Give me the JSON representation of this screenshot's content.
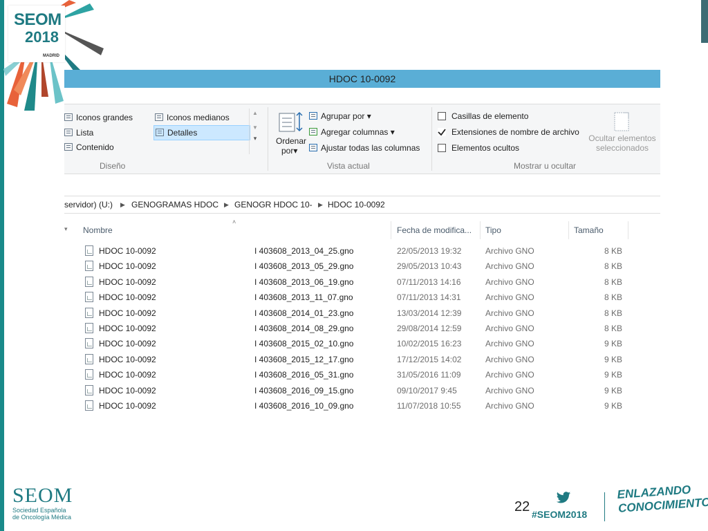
{
  "branding": {
    "logo_text": "SEOM",
    "logo_year": "2018",
    "logo_city": "MADRID",
    "accent_color": "#1f7a82",
    "footer_logo": "SEOM",
    "footer_society_line1": "Sociedad Española",
    "footer_society_line2": "de Oncología Médica",
    "page_number": "22",
    "hashtag": "#SEOM2018",
    "slogan_line1": "ENLAZANDO",
    "slogan_line2": "CONOCIMIENTO"
  },
  "window": {
    "title": "HDOC 10-0092",
    "titlebar_color": "#5aaed6"
  },
  "ribbon": {
    "layout": {
      "items": [
        {
          "label": "Iconos grandes",
          "icon": "large-icons-icon"
        },
        {
          "label": "Iconos medianos",
          "icon": "medium-icons-icon"
        },
        {
          "label": "Lista",
          "icon": "list-icon"
        },
        {
          "label": "Detalles",
          "icon": "details-icon",
          "selected": true
        },
        {
          "label": "Contenido",
          "icon": "content-icon"
        }
      ],
      "group_label": "Diseño"
    },
    "current_view": {
      "sort_label": "Ordenar",
      "sort_label2": "por",
      "group_by": "Agrupar por",
      "add_columns": "Agregar columnas",
      "fit_columns": "Ajustar todas las columnas",
      "group_label": "Vista actual"
    },
    "show_hide": {
      "item_checkboxes": {
        "label": "Casillas de elemento",
        "checked": false
      },
      "file_extensions": {
        "label": "Extensiones de nombre de archivo",
        "checked": true
      },
      "hidden_items": {
        "label": "Elementos ocultos",
        "checked": false
      },
      "hide_selected_line1": "Ocultar elementos",
      "hide_selected_line2": "seleccionados",
      "group_label": "Mostrar u ocultar"
    }
  },
  "address": {
    "segments": [
      "servidor) (U:)",
      "GENOGRAMAS HDOC",
      "GENOGR HDOC 10-",
      "HDOC 10-0092"
    ]
  },
  "columns": {
    "name": "Nombre",
    "date": "Fecha de modifica...",
    "type": "Tipo",
    "size": "Tamaño"
  },
  "files": [
    {
      "name": "HDOC 10-0092",
      "file": "I 403608_2013_04_25.gno",
      "date": "22/05/2013 19:32",
      "type": "Archivo GNO",
      "size": "8 KB"
    },
    {
      "name": "HDOC 10-0092",
      "file": "I 403608_2013_05_29.gno",
      "date": "29/05/2013 10:43",
      "type": "Archivo GNO",
      "size": "8 KB"
    },
    {
      "name": "HDOC 10-0092",
      "file": "I 403608_2013_06_19.gno",
      "date": "07/11/2013 14:16",
      "type": "Archivo GNO",
      "size": "8 KB"
    },
    {
      "name": "HDOC 10-0092",
      "file": "I 403608_2013_11_07.gno",
      "date": "07/11/2013 14:31",
      "type": "Archivo GNO",
      "size": "8 KB"
    },
    {
      "name": "HDOC 10-0092",
      "file": "I 403608_2014_01_23.gno",
      "date": "13/03/2014 12:39",
      "type": "Archivo GNO",
      "size": "8 KB"
    },
    {
      "name": "HDOC 10-0092",
      "file": "I 403608_2014_08_29.gno",
      "date": "29/08/2014 12:59",
      "type": "Archivo GNO",
      "size": "8 KB"
    },
    {
      "name": "HDOC 10-0092",
      "file": "I 403608_2015_02_10.gno",
      "date": "10/02/2015 16:23",
      "type": "Archivo GNO",
      "size": "9 KB"
    },
    {
      "name": "HDOC 10-0092",
      "file": "I 403608_2015_12_17.gno",
      "date": "17/12/2015 14:02",
      "type": "Archivo GNO",
      "size": "9 KB"
    },
    {
      "name": "HDOC 10-0092",
      "file": "I 403608_2016_05_31.gno",
      "date": "31/05/2016 11:09",
      "type": "Archivo GNO",
      "size": "9 KB"
    },
    {
      "name": "HDOC 10-0092",
      "file": "I 403608_2016_09_15.gno",
      "date": "09/10/2017 9:45",
      "type": "Archivo GNO",
      "size": "9 KB"
    },
    {
      "name": "HDOC 10-0092",
      "file": "I 403608_2016_10_09.gno",
      "date": "11/07/2018 10:55",
      "type": "Archivo GNO",
      "size": "9 KB"
    }
  ]
}
